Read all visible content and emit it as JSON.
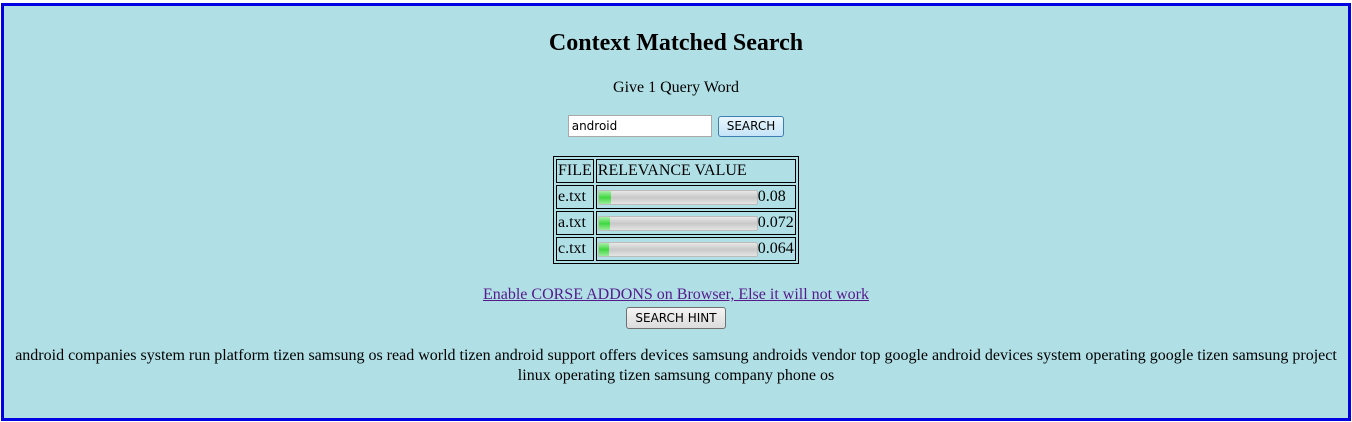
{
  "title": "Context Matched Search",
  "prompt": "Give 1 Query Word",
  "search": {
    "value": "android",
    "button_label": "SEARCH"
  },
  "results": {
    "headers": {
      "file": "FILE",
      "relevance": "RELEVANCE VALUE"
    },
    "rows": [
      {
        "file": "e.txt",
        "value": "0.08",
        "fill": 0.08
      },
      {
        "file": "a.txt",
        "value": "0.072",
        "fill": 0.072
      },
      {
        "file": "c.txt",
        "value": "0.064",
        "fill": 0.064
      }
    ]
  },
  "cors_link": "Enable CORSE ADDONS on Browser, Else it will not work",
  "hint_button_label": "SEARCH HINT",
  "hint_words": "android companies system run platform tizen samsung os read world tizen android support offers devices samsung androids vendor top google android devices system operating google tizen samsung project linux operating tizen samsung company phone os"
}
